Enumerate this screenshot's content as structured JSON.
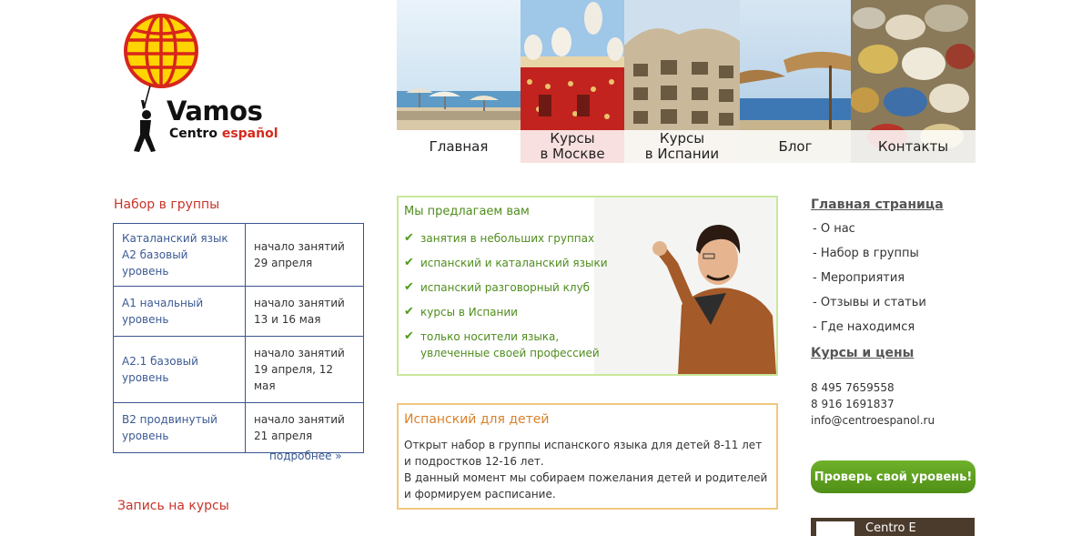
{
  "logo": {
    "title": "Vamos",
    "subtitle_part1": "Centro",
    "subtitle_part2": "español",
    "icon": "globe-balloon-icon"
  },
  "nav": [
    {
      "label": "Главная"
    },
    {
      "label": "Курсы\nв Москве"
    },
    {
      "label": "Курсы\nв Испании"
    },
    {
      "label": "Блог"
    },
    {
      "label": "Контакты"
    }
  ],
  "left": {
    "groups_title": "Набор в группы",
    "schedule": [
      {
        "course": "Каталанский язык А2 базовый уровень",
        "start": "начало занятий 29 апреля"
      },
      {
        "course": "А1 начальный уровень",
        "start": "начало занятий 13 и 16 мая"
      },
      {
        "course": "А2.1 базовый уровень",
        "start": "начало занятий 19 апреля, 12 мая"
      },
      {
        "course": "В2 продвинутый уровень",
        "start": "начало занятий 21 апреля"
      }
    ],
    "more_link": "подробнее »",
    "enroll_title": "Запись на курсы"
  },
  "offer": {
    "title": "Мы предлагаем вам",
    "items": [
      "занятия в небольших группах",
      "испанский и каталанский языки",
      "испанский разговорный клуб",
      "курсы в Испании",
      "только носители языка,\nувлеченные своей профессией"
    ]
  },
  "kids": {
    "title": "Испанский для детей",
    "text": "Открыт набор в группы испанского языка для детей 8-11 лет и подростков 12-16 лет.\nВ данный момент мы собираем пожелания детей и родителей и формируем расписание."
  },
  "right": {
    "main_heading": "Главная страница",
    "menu": [
      "- О нас",
      "- Набор в группы",
      "- Мероприятия",
      "- Отзывы и статьи",
      "- Где находимся"
    ],
    "courses_heading": "Курсы и цены",
    "phone1": "8 495 7659558",
    "phone2": "8 916 1691837",
    "email": "info@centroespanol.ru",
    "level_button": "Проверь свой уровень!",
    "fb_text": "Centro E"
  },
  "colors": {
    "green": "#4f8d1d",
    "red": "#c8342a",
    "orange": "#d9822b",
    "link": "#3b5a93"
  }
}
